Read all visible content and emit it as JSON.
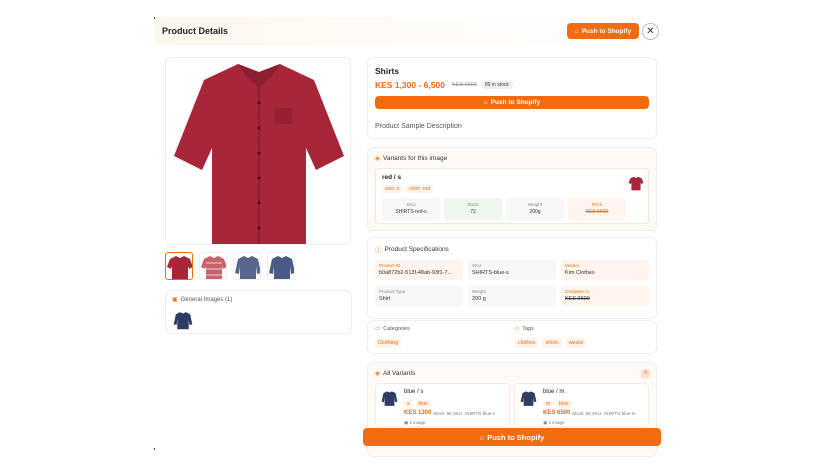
{
  "header": {
    "title": "Product Details",
    "push_label": "Push to Shopify",
    "close": "✕"
  },
  "product": {
    "name": "Shirts",
    "price": "KES 1,300 - 6,500",
    "compare_price": "KES 2600",
    "stock_badge": "89 in stock",
    "push_label": "Push to Shopify",
    "description": "Product Sample Description"
  },
  "general_images": {
    "label": "General Images (1)"
  },
  "image_variants": {
    "title": "Variants for this image",
    "variant": {
      "name": "red / s",
      "tags": [
        "size: s",
        "color: red"
      ],
      "stats": [
        {
          "label": "SKU",
          "value": "SHIRTS-red-s"
        },
        {
          "label": "Stock",
          "value": "72"
        },
        {
          "label": "Weight",
          "value": "200g"
        },
        {
          "label": "Price",
          "value": "KES 6500"
        }
      ]
    }
  },
  "specs": {
    "title": "Product Specifications",
    "items": [
      {
        "label": "Product ID",
        "value": "b0a872b2-513f-48ab-93f1-7..."
      },
      {
        "label": "SKU",
        "value": "SHIRTS-blue-s"
      },
      {
        "label": "Vendor",
        "value": "Kim Clothes"
      },
      {
        "label": "Product Type",
        "value": "Shirt"
      },
      {
        "label": "Weight",
        "value": "200 g"
      },
      {
        "label": "Compare At",
        "value": "KES 2600"
      }
    ]
  },
  "categories": {
    "label": "Categories",
    "items": [
      "Clothing"
    ]
  },
  "tags": {
    "label": "Tags",
    "items": [
      "clothes",
      "shirts",
      "wears"
    ]
  },
  "all_variants": {
    "title": "All Variants",
    "count": "4",
    "items": [
      {
        "name": "blue / s",
        "tags": [
          "s",
          "blue"
        ],
        "price": "KES 1300",
        "stock": "Stock: 96",
        "sku": "SKU: SHIRTS-blue-s",
        "images": "1 image"
      },
      {
        "name": "blue / m",
        "tags": [
          "m",
          "blue"
        ],
        "price": "KES 6500",
        "stock": "Stock: 95",
        "sku": "SKU: SHIRTS-blue-m",
        "images": "1 image"
      }
    ]
  },
  "footer": {
    "push_label": "Push to Shopify"
  },
  "colors": {
    "accent": "#f26b0f",
    "shirt_red": "#a8263a",
    "shirt_blue": "#2f3d63"
  }
}
